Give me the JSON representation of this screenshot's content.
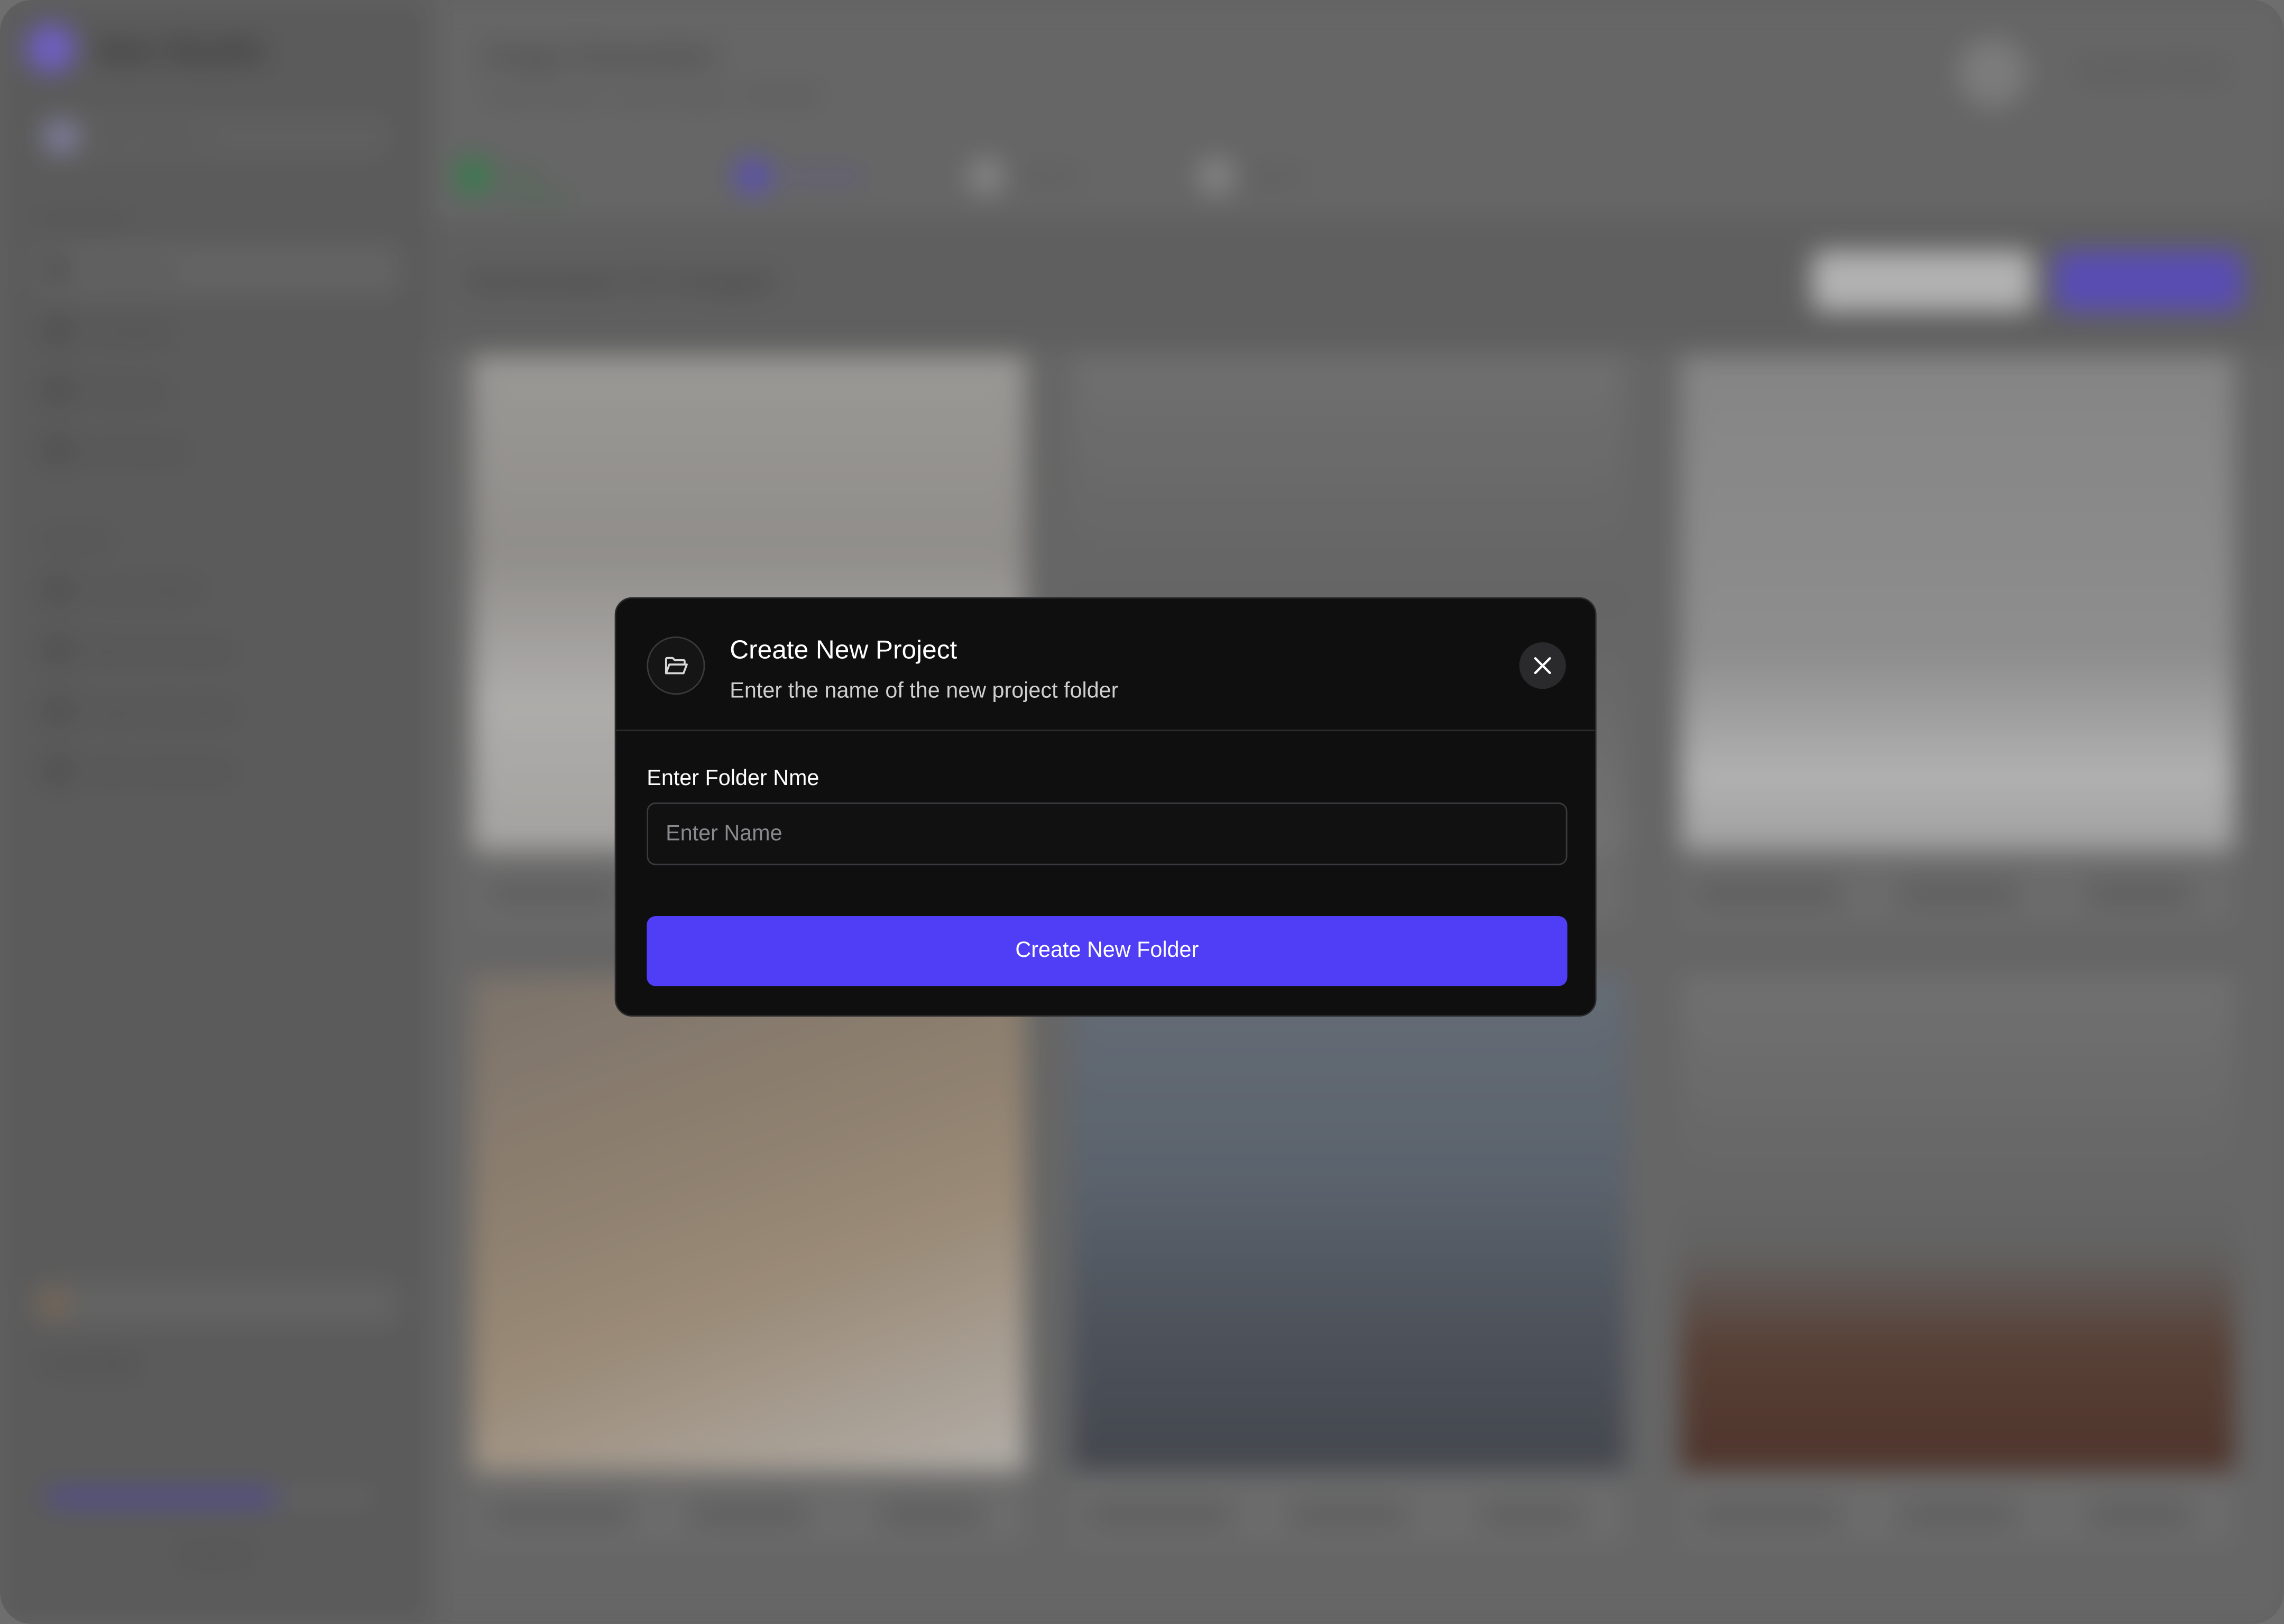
{
  "background": {
    "app_name": "Nan Studio",
    "workspace": "Shift Solutions",
    "sidebar_sections": [
      {
        "label": "Get started",
        "items": [
          "Dashboard",
          "Templates",
          "Requests",
          "My Projects"
        ]
      },
      {
        "label": "Products",
        "items": [
          "Create Model",
          "Batch Generation",
          "Image Generation",
          "Video Generation"
        ]
      }
    ],
    "plan": {
      "badge": "Go Premium",
      "title": "Free Plan",
      "storage_label": "Used Storage",
      "storage_fraction": 0.7,
      "button": "Upgrade"
    },
    "page_title": "Image Generation",
    "page_subtitle": "Create Project > Select Images > Generate",
    "user_name": "Cameron Rivers",
    "steps": [
      "Add Product",
      "Generate",
      "Review",
      "Export"
    ],
    "gallery_title": "Generated 15 Images",
    "new_button": "New Project",
    "tile_actions": [
      "Edit Image",
      "Variation",
      "Save"
    ]
  },
  "modal": {
    "icon": "folder-open-icon",
    "title": "Create New Project",
    "subtitle": "Enter the name of the new project folder",
    "field_label": "Enter Folder Nme",
    "field_placeholder": "Enter Name",
    "field_value": "",
    "submit_label": "Create New Folder",
    "close_icon": "close-icon"
  },
  "colors": {
    "accent": "#4f3ef5",
    "modal_bg": "#0f0f10",
    "overlay": "#6e6e6e"
  }
}
